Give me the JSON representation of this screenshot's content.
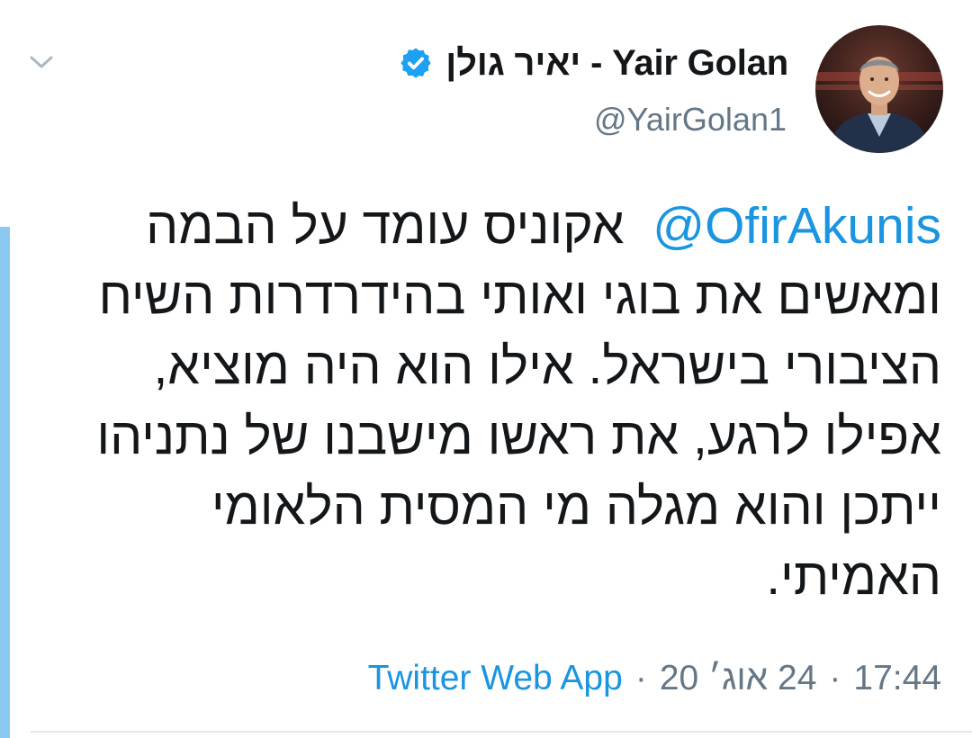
{
  "tweet": {
    "author": {
      "display_name": "יאיר גולן - Yair Golan",
      "handle": "@YairGolan1",
      "verified": true,
      "avatar_icon": "avatar-photo"
    },
    "mention": "@OfirAkunis",
    "body_lines": [
      "אקוניס עומד על הבמה",
      "ומאשים את בוגי ואותי בהידרדרות השיח",
      "הציבורי בישראל. אילו הוא היה מוציא,",
      "אפילו לרגע, את ראשו מישבנו של נתניהו",
      "ייתכן והוא מגלה מי המסית הלאומי",
      "האמיתי."
    ],
    "meta": {
      "source": "Twitter Web App",
      "date": "24 אוג׳ 20",
      "time": "17:44",
      "separator": "·"
    }
  },
  "icons": {
    "menu": "chevron-down-icon",
    "verified": "verified-badge-icon"
  },
  "colors": {
    "link": "#1b95e0",
    "text": "#14171a",
    "muted": "#657786",
    "thread_line": "#8cc9f2",
    "divider": "#e1e8ed"
  }
}
